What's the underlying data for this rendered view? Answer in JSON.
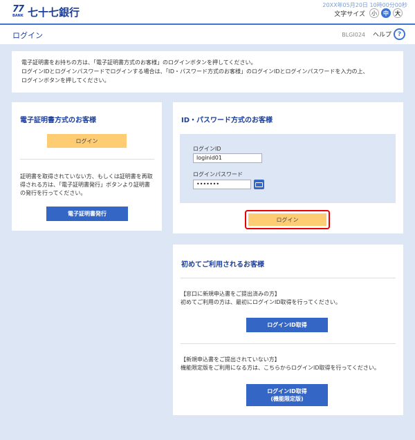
{
  "header": {
    "logo_number": "77",
    "logo_bank": "BANK",
    "bank_name": "七十七銀行",
    "datetime": "20XX年05月20日 10時00分00秒",
    "font_size_label": "文字サイズ",
    "font_small": "小",
    "font_medium": "中",
    "font_large": "大"
  },
  "titlebar": {
    "title": "ログイン",
    "screen_id": "BLGI024",
    "help_label": "ヘルプ",
    "help_icon": "?"
  },
  "notice": {
    "line1": "電子証明書をお持ちの方は、「電子証明書方式のお客様」のログインボタンを押してください。",
    "line2": "ログインIDとログインパスワードでログインする場合は、「ID・パスワード方式のお客様」のログインIDとログインパスワードを入力の上、",
    "line3": "ログインボタンを押してください。"
  },
  "cert_panel": {
    "title": "電子証明書方式のお客様",
    "login_label": "ログイン",
    "desc1": "証明書を取得されていない方、もしくは証明書を再取",
    "desc2": "得される方は、「電子証明書発行」ボタンより証明書",
    "desc3": "の発行を行ってください。",
    "issue_label": "電子証明書発行"
  },
  "idpw_panel": {
    "title": "ID・パスワード方式のお客様",
    "id_label": "ログインID",
    "id_value": "loginid01",
    "pw_label": "ログインパスワード",
    "pw_value": "•••••••",
    "login_label": "ログイン"
  },
  "first_panel": {
    "title": "初めてご利用されるお客様",
    "sec1_head": "【窓口に新規申込書をご提出済みの方】",
    "sec1_text": "初めてご利用の方は、最初にログインID取得を行ってください。",
    "get_id_label": "ログインID取得",
    "sec2_head": "【新規申込書をご提出されていない方】",
    "sec2_text": "機能限定版をご利用になる方は、こちらからログインID取得を行ってください。",
    "get_id_limited_line1": "ログインID取得",
    "get_id_limited_line2": "(機能限定版)"
  },
  "colors": {
    "brand": "#1d3f9a",
    "accent": "#3466c6",
    "login_button": "#fdcc73",
    "background": "#dde6f4",
    "highlight": "#ee0000"
  }
}
